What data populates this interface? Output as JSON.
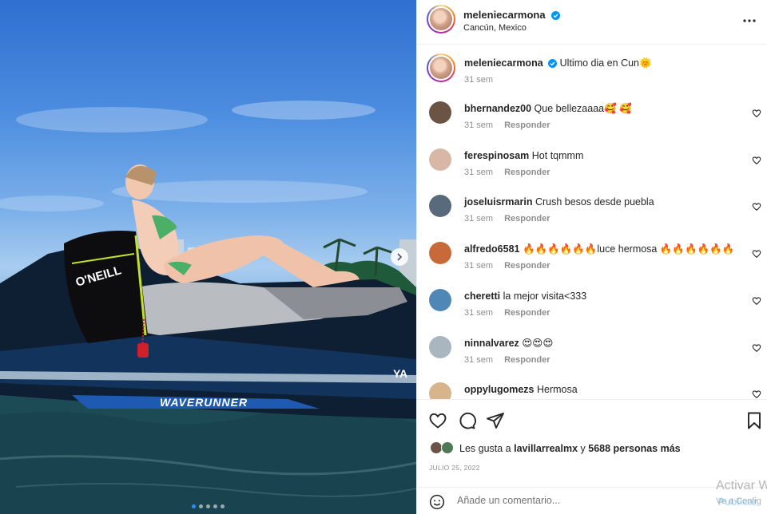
{
  "post": {
    "username": "meleniecarmona",
    "location": "Cancún, Mexico",
    "caption": "Ultimo dia en Cun",
    "caption_emoji": "🌞",
    "caption_time": "31 sem",
    "carousel": {
      "slide_count": 5,
      "active_slide": 1
    }
  },
  "media": {
    "jet_brand": "O'NEILL",
    "jet_model": "WAVERUNNER",
    "jet_logo": "YA"
  },
  "comments": [
    {
      "user": "bhernandez00",
      "text": "Que bellezaaaa🥰 🥰",
      "time": "31 sem",
      "reply": "Responder",
      "avatar_color": "#6b5443"
    },
    {
      "user": "ferespinosam",
      "text": "Hot tqmmm",
      "time": "31 sem",
      "reply": "Responder",
      "avatar_color": "#d9b7a7"
    },
    {
      "user": "joseluisrmarin",
      "text": "Crush besos desde puebla",
      "time": "31 sem",
      "reply": "Responder",
      "avatar_color": "#5a6a7d"
    },
    {
      "user": "alfredo6581",
      "text": "🔥🔥🔥🔥🔥🔥luce hermosa 🔥🔥🔥🔥🔥🔥",
      "time": "31 sem",
      "reply": "Responder",
      "avatar_color": "#c8693a"
    },
    {
      "user": "cheretti",
      "text": "la mejor visita<333",
      "time": "31 sem",
      "reply": "Responder",
      "avatar_color": "#4f87b6"
    },
    {
      "user": "ninnalvarez",
      "text": "😍😍😍",
      "time": "31 sem",
      "reply": "Responder",
      "avatar_color": "#a9b6bf"
    },
    {
      "user": "oppylugomezs",
      "text": "Hermosa",
      "time": "",
      "reply": "",
      "avatar_color": "#d7b48c"
    }
  ],
  "likes": {
    "prefix": "Les gusta a",
    "liker": "lavillarrealmx",
    "middle": "y",
    "count_text": "5688 personas más"
  },
  "date": "JULIO 25, 2022",
  "add_comment": {
    "placeholder": "Añade un comentario...",
    "publish": "Publicar"
  },
  "watermark": {
    "title": "Activar W",
    "subtitle": "Ve a Config"
  },
  "icons": [
    "verified-badge-icon",
    "more-options-icon",
    "heart-icon",
    "comment-icon",
    "share-icon",
    "bookmark-icon",
    "emoji-icon",
    "chevron-right-icon"
  ],
  "colors": {
    "verified": "#0095f6",
    "link": "#00376b",
    "muted": "#8e8e8e",
    "publish": "#b2dffc"
  }
}
